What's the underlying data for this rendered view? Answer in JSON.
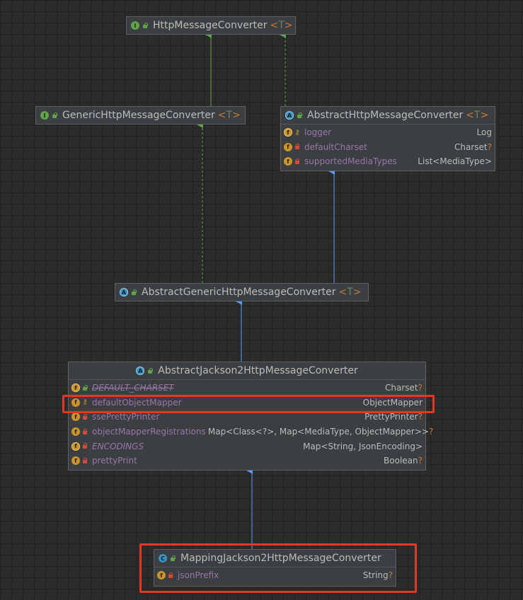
{
  "colors": {
    "background": "#2b2b2b",
    "node": "#3c3f41",
    "highlight": "#e53524",
    "extends_arrow": "#589df6",
    "implements_arrow": "#5fa34b"
  },
  "nodes": {
    "httpMessageConverter": {
      "name": "HttpMessageConverter",
      "generic_open": "<",
      "type_param": "T",
      "generic_close": ">",
      "kind": "interface-icon"
    },
    "genericHttpMessageConverter": {
      "name": "GenericHttpMessageConverter",
      "generic_open": "<",
      "type_param": "T",
      "generic_close": ">",
      "kind": "interface-icon"
    },
    "abstractHttpMessageConverter": {
      "name": "AbstractHttpMessageConverter",
      "generic_open": "<",
      "type_param": "T",
      "generic_close": ">",
      "kind": "abstract-class-icon",
      "fields": [
        {
          "name": "logger",
          "type": "Log",
          "suffix": "",
          "visibility": "protected",
          "static": true
        },
        {
          "name": "defaultCharset",
          "type": "Charset",
          "suffix": "?",
          "visibility": "private",
          "static": false
        },
        {
          "name": "supportedMediaTypes",
          "type": "List<MediaType>",
          "suffix": "",
          "visibility": "private",
          "static": false
        }
      ]
    },
    "abstractGenericHttpMessageConverter": {
      "name": "AbstractGenericHttpMessageConverter",
      "generic_open": "<",
      "type_param": "T",
      "generic_close": ">",
      "kind": "abstract-class-icon"
    },
    "abstractJackson2HttpMessageConverter": {
      "name": "AbstractJackson2HttpMessageConverter",
      "kind": "abstract-class-icon",
      "fields": [
        {
          "name": "DEFAULT_CHARSET",
          "type": "Charset",
          "suffix": "?",
          "visibility": "public",
          "static": true,
          "deprecated": true
        },
        {
          "name": "defaultObjectMapper",
          "type": "ObjectMapper",
          "suffix": "",
          "visibility": "protected",
          "static": false
        },
        {
          "name": "ssePrettyPrinter",
          "type": "PrettyPrinter",
          "suffix": "?",
          "visibility": "private",
          "static": false
        },
        {
          "name": "objectMapperRegistrations",
          "type": "Map<Class<?>, Map<MediaType, ObjectMapper>>",
          "suffix": "?",
          "visibility": "private",
          "static": false
        },
        {
          "name": "ENCODINGS",
          "type": "Map<String, JsonEncoding>",
          "suffix": "",
          "visibility": "private",
          "static": true,
          "italic": true
        },
        {
          "name": "prettyPrint",
          "type": "Boolean",
          "suffix": "?",
          "visibility": "private",
          "static": false
        }
      ]
    },
    "mappingJackson2HttpMessageConverter": {
      "name": "MappingJackson2HttpMessageConverter",
      "kind": "class-icon",
      "fields": [
        {
          "name": "jsonPrefix",
          "type": "String",
          "suffix": "?",
          "visibility": "private",
          "static": false
        }
      ]
    }
  },
  "edges": [
    {
      "from": "genericHttpMessageConverter",
      "to": "httpMessageConverter",
      "kind": "extends-interface"
    },
    {
      "from": "abstractHttpMessageConverter",
      "to": "httpMessageConverter",
      "kind": "implements"
    },
    {
      "from": "abstractGenericHttpMessageConverter",
      "to": "genericHttpMessageConverter",
      "kind": "implements"
    },
    {
      "from": "abstractGenericHttpMessageConverter",
      "to": "abstractHttpMessageConverter",
      "kind": "extends"
    },
    {
      "from": "abstractJackson2HttpMessageConverter",
      "to": "abstractGenericHttpMessageConverter",
      "kind": "extends"
    },
    {
      "from": "mappingJackson2HttpMessageConverter",
      "to": "abstractJackson2HttpMessageConverter",
      "kind": "extends"
    }
  ]
}
